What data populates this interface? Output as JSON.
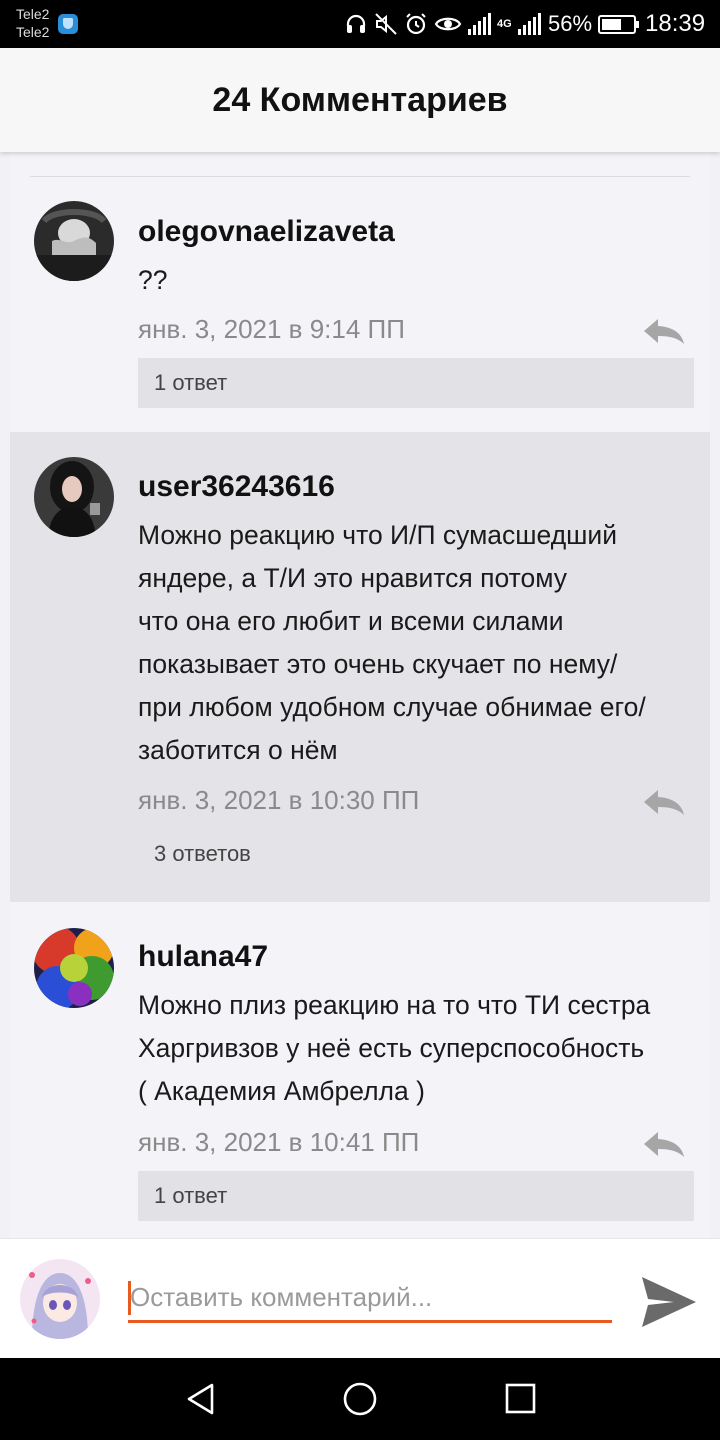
{
  "status_bar": {
    "carrier_1": "Tele2",
    "carrier_2": "Tele2",
    "network": "4G",
    "battery": "56%",
    "battery_fraction": 0.56,
    "time": "18:39"
  },
  "header": {
    "title": "24 Комментариев"
  },
  "comments": [
    {
      "username": "olegovnaelizaveta",
      "text": "??",
      "timestamp": "янв. 3, 2021 в 9:14 ПП",
      "replies": "1 ответ"
    },
    {
      "username": "user36243616",
      "text_lines": [
        "Можно реакцию что И/П сумасшедший",
        "яндере, а Т/И это нравится потому",
        "что она его любит и всеми силами",
        "показывает это очень скучает по нему/",
        "при любом удобном случае обнимае его/",
        "заботится о нём"
      ],
      "timestamp": "янв. 3, 2021 в 10:30 ПП",
      "replies": "3 ответов"
    },
    {
      "username": "hulana47",
      "text_lines": [
        "Можно плиз реакцию на то что ТИ сестра",
        "Харгривзов у неё есть суперспособность",
        "(  Академия Амбрелла )"
      ],
      "timestamp": "янв. 3, 2021 в 10:41 ПП",
      "replies": "1 ответ"
    }
  ],
  "compose": {
    "placeholder": "Оставить комментарий..."
  },
  "colors": {
    "accent": "#e85a1e",
    "highlight_bg": "#e4e4e8",
    "muted_text": "#8a8a8a"
  },
  "icons": [
    "headphones-icon",
    "mute-icon",
    "alarm-icon",
    "eye-icon",
    "signal-icon",
    "battery-icon",
    "reply-icon",
    "send-icon",
    "back-icon",
    "home-icon",
    "recents-icon"
  ]
}
